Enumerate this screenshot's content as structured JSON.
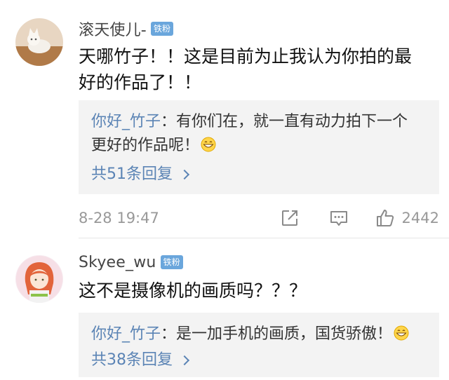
{
  "comments": [
    {
      "username": "滚天使儿-",
      "badge": "铁粉",
      "text_lines": [
        "天哪竹子！！这是目前为止我认为你拍的最",
        "好的作品了！！"
      ],
      "reply": {
        "author": "你好_竹子",
        "lines": [
          "：有你们在，就一直有动力拍下一个",
          "更好的作品呢！"
        ],
        "emoji": "grinning-emoji"
      },
      "more_replies": "共51条回复",
      "timestamp": "8-28 19:47",
      "likes": "2442"
    },
    {
      "username": "Skyee_wu",
      "badge": "铁粉",
      "text_lines": [
        "这不是摄像机的画质吗？？？"
      ],
      "reply": {
        "author": "你好_竹子",
        "lines": [
          "：是一加手机的画质，国货骄傲！"
        ],
        "emoji": "grinning-emoji"
      },
      "more_replies": "共38条回复"
    }
  ],
  "colors": {
    "link": "#5b84b5",
    "badge": "#6aa6dc",
    "reply_bg": "#f3f3f3",
    "muted": "#999999"
  }
}
